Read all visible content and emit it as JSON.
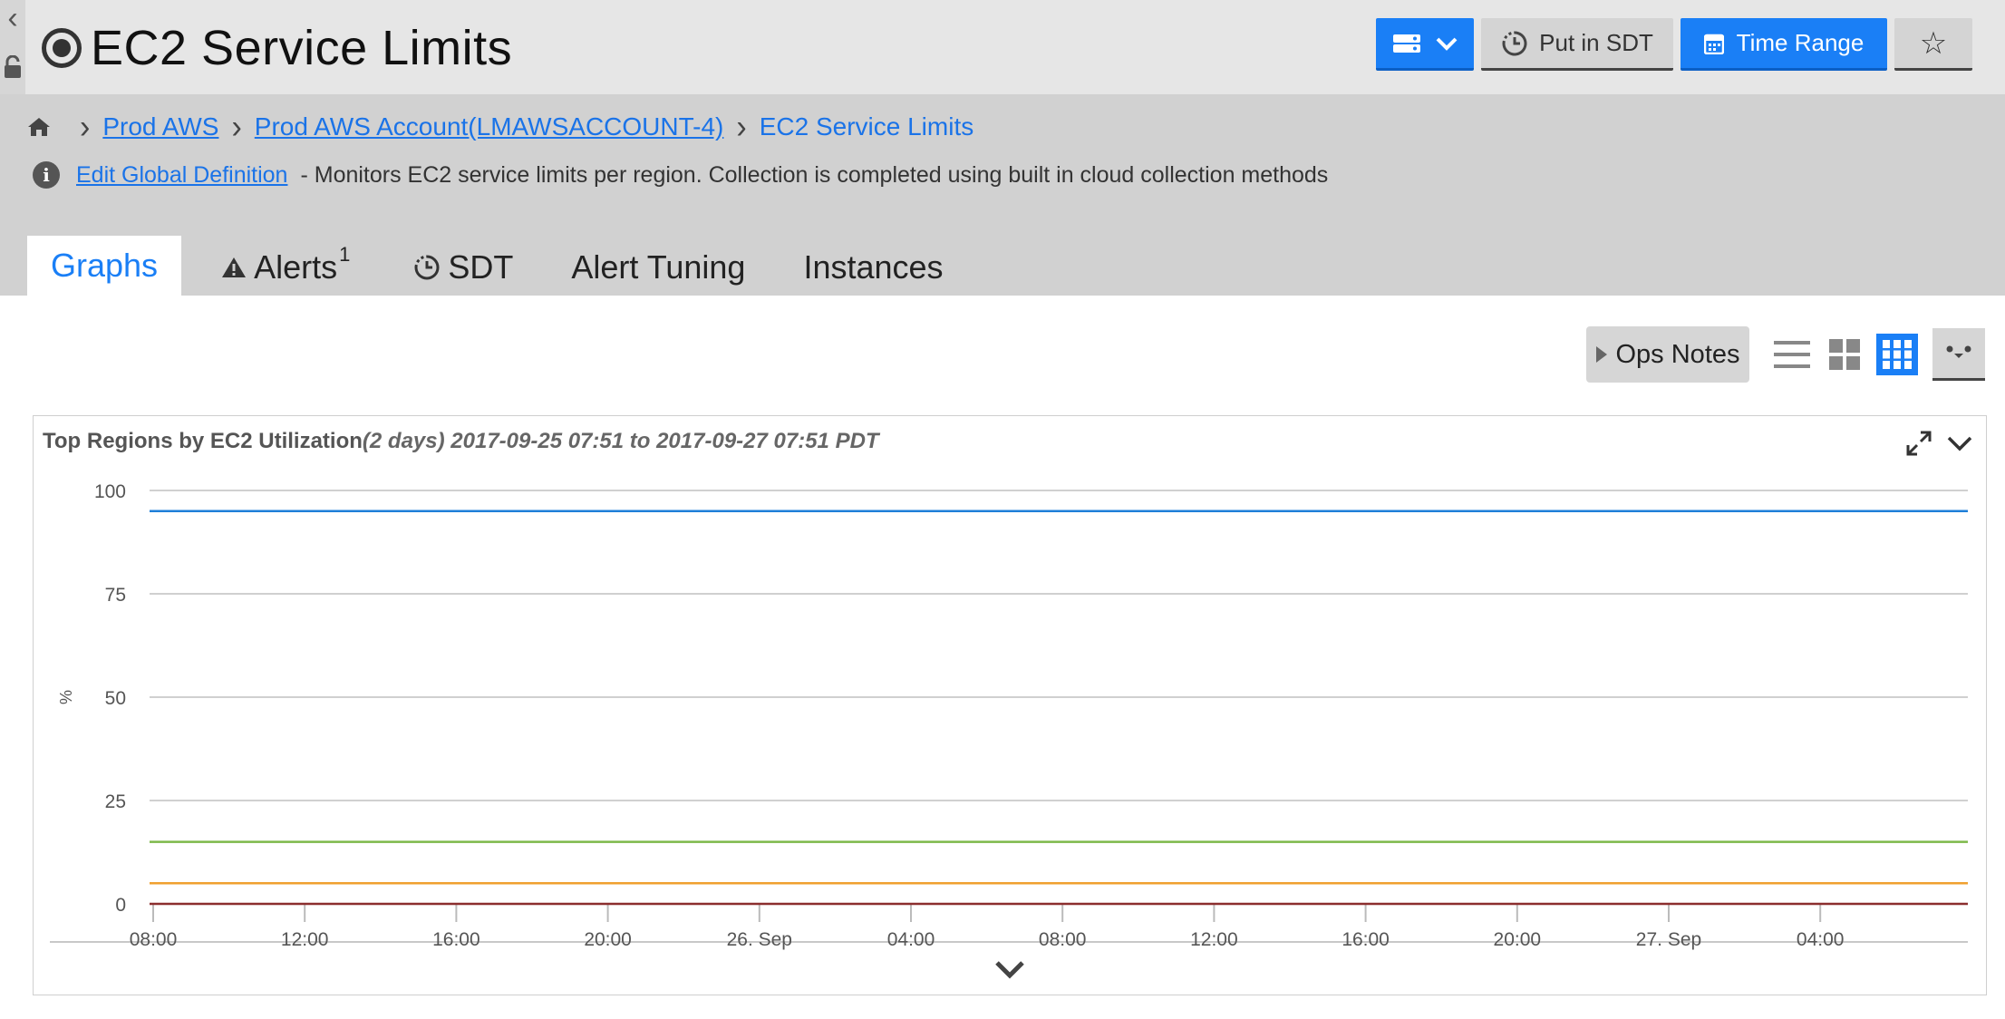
{
  "window": {
    "title": "EC2 Service Limits"
  },
  "header": {
    "put_in_sdt_label": "Put in SDT",
    "time_range_label": "Time Range",
    "star_glyph": "☆"
  },
  "breadcrumb": {
    "items": [
      {
        "label": "Prod AWS",
        "link": true
      },
      {
        "label": "Prod AWS Account(LMAWSACCOUNT-4)",
        "link": true
      },
      {
        "label": "EC2 Service Limits",
        "link": false
      }
    ]
  },
  "description": {
    "link_label": "Edit Global Definition",
    "text": "- Monitors EC2 service limits per region. Collection is completed using built in cloud collection methods"
  },
  "tabs": [
    {
      "label": "Graphs",
      "active": true
    },
    {
      "label": "Alerts",
      "badge": "1"
    },
    {
      "label": "SDT"
    },
    {
      "label": "Alert Tuning"
    },
    {
      "label": "Instances"
    }
  ],
  "toolbar": {
    "ops_notes_label": "Ops Notes"
  },
  "panel": {
    "title_bold": "Top Regions by EC2 Utilization",
    "title_italic": "(2 days) 2017-09-25 07:51 to 2017-09-27 07:51 PDT"
  },
  "colors": {
    "accent": "#1a7ff6",
    "link": "#1a73e8"
  },
  "chart_data": {
    "type": "line",
    "title": "Top Regions by EC2 Utilization(2 days) 2017-09-25 07:51 to 2017-09-27 07:51 PDT",
    "ylabel": "%",
    "ylim": [
      0,
      100
    ],
    "yticks": [
      0,
      25,
      50,
      75,
      100
    ],
    "xtick_labels": [
      "08:00",
      "12:00",
      "16:00",
      "20:00",
      "26. Sep",
      "04:00",
      "08:00",
      "12:00",
      "16:00",
      "20:00",
      "27. Sep",
      "04:00"
    ],
    "grid": true,
    "series": [
      {
        "color": "#1f7fd8",
        "value": 95
      },
      {
        "color": "#7db84a",
        "value": 15
      },
      {
        "color": "#f0a030",
        "value": 5
      },
      {
        "color": "#8b2e2e",
        "value": 0
      }
    ]
  }
}
